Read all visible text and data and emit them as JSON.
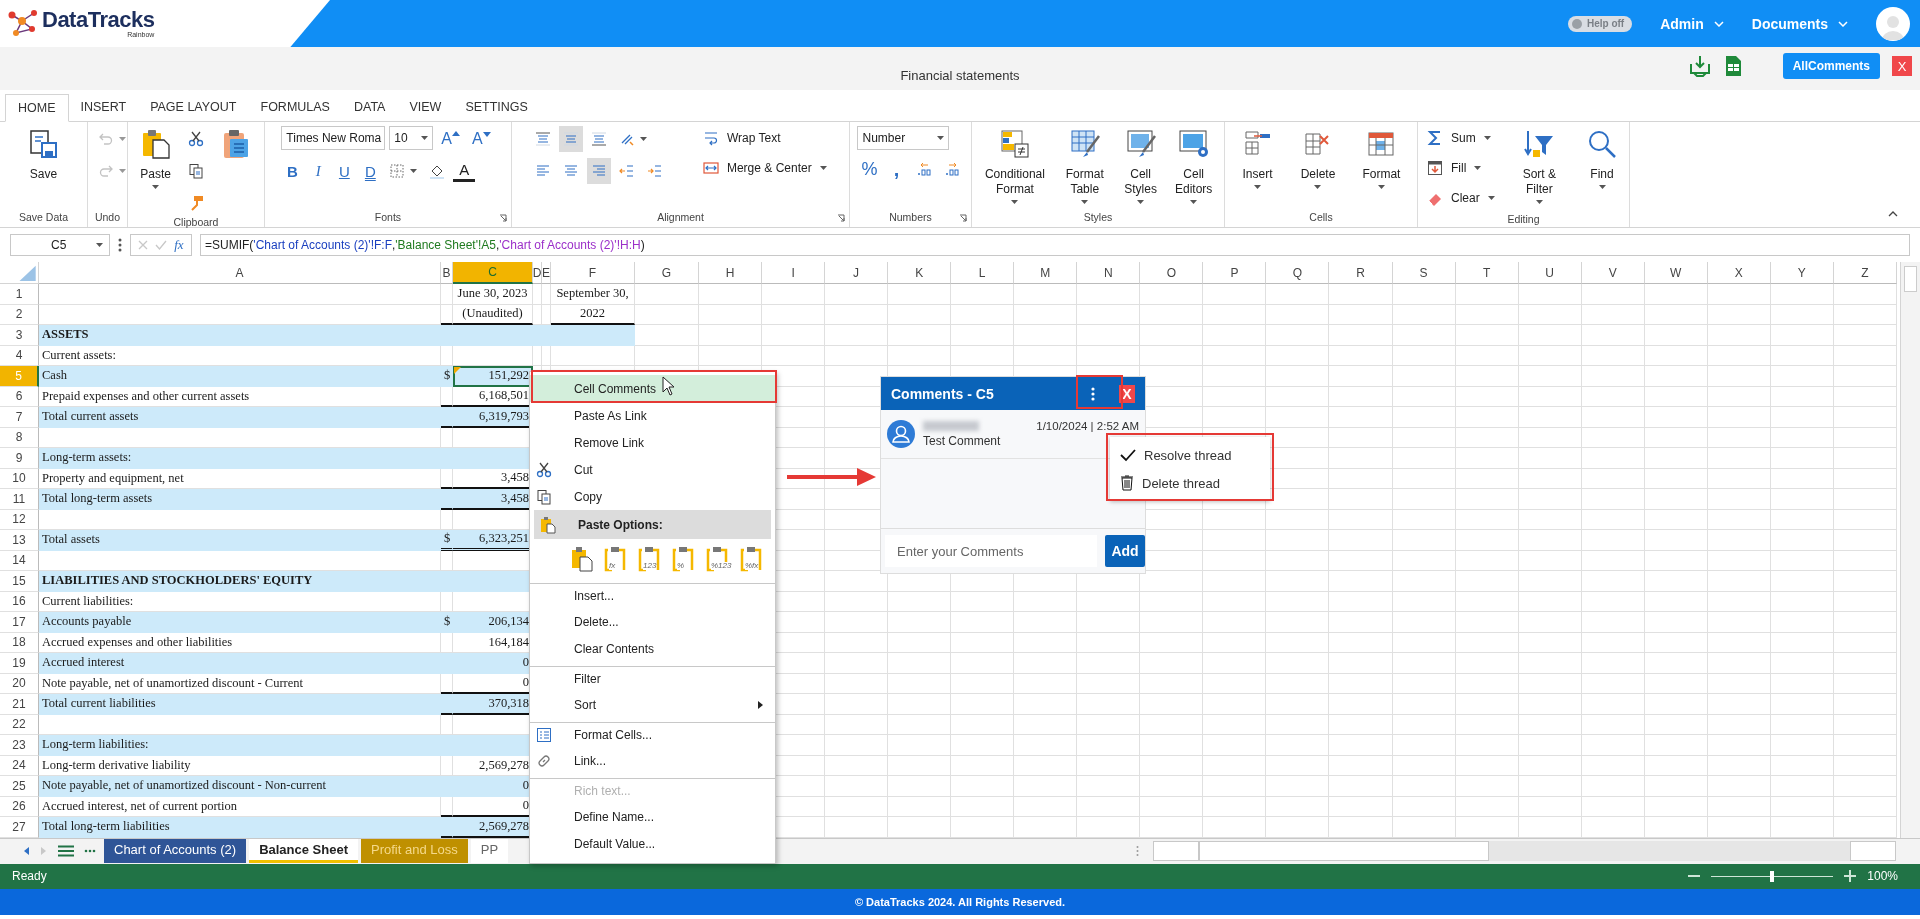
{
  "header": {
    "logo": "DataTracks",
    "logo_sub": "Rainbow",
    "help": {
      "label": "Help off",
      "on": false
    },
    "menus": [
      "Admin",
      "Documents"
    ]
  },
  "document": {
    "title": "Financial statements",
    "comments_button": "AllComments",
    "close_button": "X"
  },
  "ribbon_tabs": [
    {
      "label": "HOME",
      "selected": true
    },
    {
      "label": "INSERT",
      "selected": false
    },
    {
      "label": "PAGE LAYOUT",
      "selected": false
    },
    {
      "label": "FORMULAS",
      "selected": false
    },
    {
      "label": "DATA",
      "selected": false
    },
    {
      "label": "VIEW",
      "selected": false
    },
    {
      "label": "SETTINGS",
      "selected": false
    }
  ],
  "ribbon": {
    "groups": [
      {
        "title": "Save Data",
        "items": [
          {
            "kind": "large",
            "label": "Save"
          }
        ]
      },
      {
        "title": "Undo",
        "items": [
          {
            "kind": "column",
            "items": [
              {
                "kind": "icon",
                "caret": true,
                "disabled": true
              },
              {
                "kind": "icon",
                "caret": true,
                "disabled": true
              }
            ]
          }
        ]
      },
      {
        "title": "Clipboard",
        "items": [
          {
            "kind": "large",
            "label": "Paste",
            "caret": true
          },
          {
            "kind": "column",
            "items": [
              {
                "kind": "icon"
              },
              {
                "kind": "icon"
              },
              {
                "kind": "icon"
              }
            ]
          },
          {
            "kind": "large-icon"
          }
        ]
      },
      {
        "title": "Fonts",
        "launcher": true,
        "items": [
          {
            "kind": "column",
            "items": [
              {
                "kind": "row",
                "items": [
                  {
                    "kind": "font-select",
                    "value": "Times New Roma"
                  },
                  {
                    "kind": "size-select",
                    "value": "10"
                  },
                  {
                    "kind": "glyph-arrow",
                    "label": "A"
                  },
                  {
                    "kind": "glyph-arrow",
                    "label": "A"
                  }
                ]
              },
              {
                "kind": "row",
                "items": [
                  {
                    "kind": "bold",
                    "label": "B"
                  },
                  {
                    "kind": "italic",
                    "label": "I"
                  },
                  {
                    "kind": "underline",
                    "label": "U"
                  },
                  {
                    "kind": "double",
                    "label": "D"
                  },
                  {
                    "kind": "icon",
                    "caret": true
                  },
                  {
                    "kind": "icon"
                  },
                  {
                    "kind": "fontcolor",
                    "label": "A"
                  }
                ]
              }
            ]
          }
        ]
      },
      {
        "title": "Alignment",
        "launcher": true,
        "items": [
          {
            "kind": "column",
            "items": [
              {
                "kind": "row",
                "items": [
                  {
                    "kind": "icon",
                    "selected": false
                  },
                  {
                    "kind": "icon",
                    "selected": true
                  },
                  {
                    "kind": "icon",
                    "selected": false
                  },
                  {
                    "kind": "icon",
                    "caret": true
                  }
                ]
              },
              {
                "kind": "row",
                "items": [
                  {
                    "kind": "icon",
                    "selected": false
                  },
                  {
                    "kind": "icon",
                    "selected": false
                  },
                  {
                    "kind": "icon",
                    "selected": true
                  },
                  {
                    "kind": "icon"
                  },
                  {
                    "kind": "icon"
                  }
                ]
              }
            ]
          },
          {
            "kind": "column",
            "items": [
              {
                "kind": "small",
                "label": "Wrap Text"
              },
              {
                "kind": "small",
                "label": "Merge & Center",
                "caret": true
              }
            ]
          }
        ]
      },
      {
        "title": "Numbers",
        "launcher": true,
        "items": [
          {
            "kind": "column",
            "items": [
              {
                "kind": "format-select",
                "value": "Number"
              },
              {
                "kind": "row",
                "items": [
                  {
                    "kind": "percent",
                    "label": "%"
                  },
                  {
                    "kind": "comma",
                    "label": ","
                  },
                  {
                    "kind": "icon"
                  },
                  {
                    "kind": "icon"
                  }
                ]
              }
            ]
          }
        ]
      },
      {
        "title": "Styles",
        "items": [
          {
            "kind": "large",
            "label": "Conditional Format",
            "caret": true
          },
          {
            "kind": "large",
            "label": "Format Table",
            "caret": true
          },
          {
            "kind": "large",
            "label": "Cell Styles",
            "caret": true
          },
          {
            "kind": "large",
            "label": "Cell Editors",
            "caret": true
          }
        ]
      },
      {
        "title": "Cells",
        "items": [
          {
            "kind": "large",
            "label": "Insert",
            "caret": true
          },
          {
            "kind": "large",
            "label": "Delete",
            "caret": true
          },
          {
            "kind": "large",
            "label": "Format",
            "caret": true
          }
        ]
      },
      {
        "title": "Editing",
        "items": [
          {
            "kind": "column",
            "items": [
              {
                "kind": "small",
                "label": "Sum",
                "caret": true
              },
              {
                "kind": "small",
                "label": "Fill",
                "caret": true
              },
              {
                "kind": "small",
                "label": "Clear",
                "caret": true
              }
            ]
          },
          {
            "kind": "large",
            "label": "Sort & Filter",
            "caret": true
          },
          {
            "kind": "large",
            "label": "Find",
            "caret": true
          }
        ]
      }
    ]
  },
  "formula_bar": {
    "name_box": "C5",
    "fx": "fx",
    "segments": [
      {
        "text": "=SUMIF("
      },
      {
        "text": "'Chart of Accounts (2)'!F:F",
        "color": "#1a3fbf"
      },
      {
        "text": ","
      },
      {
        "text": "'Balance Sheet'!A5",
        "color": "#1f7a1f"
      },
      {
        "text": ","
      },
      {
        "text": "'Chart of Accounts (2)'!H:H",
        "color": "#9b2fc9"
      },
      {
        "text": ")"
      }
    ]
  },
  "sheet": {
    "columns": [
      {
        "label": "A",
        "selected": false
      },
      {
        "label": "B",
        "selected": false
      },
      {
        "label": "C",
        "selected": true
      },
      {
        "label": "D",
        "selected": false
      },
      {
        "label": "E",
        "selected": false
      },
      {
        "label": "F",
        "selected": false
      },
      {
        "label": "G",
        "selected": false
      },
      {
        "label": "H",
        "selected": false
      },
      {
        "label": "I",
        "selected": false
      },
      {
        "label": "J",
        "selected": false
      },
      {
        "label": "K",
        "selected": false
      },
      {
        "label": "L",
        "selected": false
      },
      {
        "label": "M",
        "selected": false
      },
      {
        "label": "N",
        "selected": false
      },
      {
        "label": "O",
        "selected": false
      },
      {
        "label": "P",
        "selected": false
      },
      {
        "label": "Q",
        "selected": false
      },
      {
        "label": "R",
        "selected": false
      },
      {
        "label": "S",
        "selected": false
      },
      {
        "label": "T",
        "selected": false
      },
      {
        "label": "U",
        "selected": false
      },
      {
        "label": "V",
        "selected": false
      },
      {
        "label": "W",
        "selected": false
      },
      {
        "label": "X",
        "selected": false
      },
      {
        "label": "Y",
        "selected": false
      },
      {
        "label": "Z",
        "selected": false
      }
    ],
    "rows": [
      {
        "number": "1",
        "kind": "normal",
        "band": false,
        "rule": false,
        "selected": false,
        "c": "June 30, 2023",
        "f": "September 30,"
      },
      {
        "number": "2",
        "kind": "normal",
        "band": false,
        "rule": true,
        "selected": false,
        "c": "(Unaudited)",
        "f": "2022"
      },
      {
        "number": "3",
        "kind": "heading",
        "band": true,
        "band_wide": true,
        "rule": false,
        "selected": false,
        "a": "ASSETS"
      },
      {
        "number": "4",
        "kind": "normal",
        "band": false,
        "rule": false,
        "selected": false,
        "a": "Current assets:"
      },
      {
        "number": "5",
        "kind": "normal",
        "band": true,
        "rule": false,
        "selected": true,
        "comment": true,
        "a": "Cash",
        "b": "$",
        "c": "151,292"
      },
      {
        "number": "6",
        "kind": "normal",
        "band": false,
        "rule": true,
        "selected": false,
        "a": "Prepaid expenses and other current assets",
        "c": "6,168,501"
      },
      {
        "number": "7",
        "kind": "normal",
        "band": true,
        "rule": true,
        "selected": false,
        "a": "Total current assets",
        "c": "6,319,793"
      },
      {
        "number": "8",
        "kind": "normal",
        "band": false,
        "rule": false,
        "selected": false
      },
      {
        "number": "9",
        "kind": "normal",
        "band": true,
        "rule": false,
        "selected": false,
        "a": "Long-term assets:"
      },
      {
        "number": "10",
        "kind": "normal",
        "band": false,
        "rule": true,
        "selected": false,
        "a": "Property and equipment, net",
        "c": "3,458"
      },
      {
        "number": "11",
        "kind": "normal",
        "band": true,
        "rule": true,
        "selected": false,
        "a": "Total long-term assets",
        "c": "3,458"
      },
      {
        "number": "12",
        "kind": "normal",
        "band": false,
        "rule": false,
        "selected": false
      },
      {
        "number": "13",
        "kind": "normal",
        "band": true,
        "rule": true,
        "double_rule": true,
        "selected": false,
        "a": "Total assets",
        "b": "$",
        "c": "6,323,251"
      },
      {
        "number": "14",
        "kind": "normal",
        "band": false,
        "rule": false,
        "selected": false
      },
      {
        "number": "15",
        "kind": "heading",
        "band": true,
        "rule": false,
        "selected": false,
        "a": "LIABILITIES AND STOCKHOLDERS' EQUITY"
      },
      {
        "number": "16",
        "kind": "normal",
        "band": false,
        "rule": false,
        "selected": false,
        "a": "Current liabilities:"
      },
      {
        "number": "17",
        "kind": "normal",
        "band": true,
        "rule": false,
        "selected": false,
        "a": "Accounts payable",
        "b": "$",
        "c": "206,134"
      },
      {
        "number": "18",
        "kind": "normal",
        "band": false,
        "rule": false,
        "selected": false,
        "a": "Accrued expenses and other liabilities",
        "c": "164,184"
      },
      {
        "number": "19",
        "kind": "normal",
        "band": true,
        "rule": false,
        "selected": false,
        "a": "Accrued interest",
        "c": "0"
      },
      {
        "number": "20",
        "kind": "normal",
        "band": false,
        "rule": true,
        "selected": false,
        "a": "Note payable, net of unamortized discount - Current",
        "c": "0"
      },
      {
        "number": "21",
        "kind": "normal",
        "band": true,
        "rule": true,
        "selected": false,
        "a": "Total current liabilities",
        "c": "370,318"
      },
      {
        "number": "22",
        "kind": "normal",
        "band": false,
        "rule": false,
        "selected": false
      },
      {
        "number": "23",
        "kind": "normal",
        "band": true,
        "rule": false,
        "selected": false,
        "a": "Long-term liabilities:"
      },
      {
        "number": "24",
        "kind": "normal",
        "band": false,
        "rule": false,
        "selected": false,
        "a": "Long-term derivative liability",
        "c": "2,569,278"
      },
      {
        "number": "25",
        "kind": "normal",
        "band": true,
        "rule": false,
        "selected": false,
        "a": "Note payable, net of unamortized discount - Non-current",
        "c": "0"
      },
      {
        "number": "26",
        "kind": "normal",
        "band": false,
        "rule": true,
        "selected": false,
        "a": "Accrued interest, net of current portion",
        "c": "0"
      },
      {
        "number": "27",
        "kind": "normal",
        "band": true,
        "rule": true,
        "selected": false,
        "a": "Total long-term liabilities",
        "c": "2,569,278"
      }
    ]
  },
  "sheet_tabs": [
    {
      "label": "Chart of Accounts (2)",
      "selected": false,
      "color": "#2f5597"
    },
    {
      "label": "Balance Sheet",
      "selected": true,
      "color": "#f0c000"
    },
    {
      "label": "Profit and Loss",
      "selected": false,
      "color": "#bf9000"
    },
    {
      "label": "PP",
      "selected": false,
      "color": "#ffffff"
    }
  ],
  "context_menu": {
    "items": [
      {
        "kind": "plain",
        "label": "Cell Comments",
        "selected": true,
        "divider": false,
        "disabled": false
      },
      {
        "kind": "plain",
        "label": "Paste As Link",
        "selected": false,
        "divider": false,
        "disabled": false
      },
      {
        "kind": "plain",
        "label": "Remove Link",
        "selected": false,
        "divider": false,
        "disabled": false
      },
      {
        "kind": "cut",
        "label": "Cut",
        "selected": false,
        "divider": false,
        "disabled": false
      },
      {
        "kind": "copy",
        "label": "Copy",
        "selected": false,
        "divider": false,
        "disabled": false
      },
      {
        "kind": "header",
        "label": "Paste Options:"
      },
      {
        "kind": "paste-row",
        "badges": [
          "fx",
          "123",
          "%",
          "%123",
          "%fx"
        ]
      },
      {
        "kind": "plain",
        "label": "Insert...",
        "selected": false,
        "divider": true,
        "disabled": false
      },
      {
        "kind": "plain",
        "label": "Delete...",
        "selected": false,
        "divider": false,
        "disabled": false
      },
      {
        "kind": "plain",
        "label": "Clear Contents",
        "selected": false,
        "divider": false,
        "disabled": false
      },
      {
        "kind": "plain",
        "label": "Filter",
        "selected": false,
        "divider": true,
        "disabled": false
      },
      {
        "kind": "submenu",
        "label": "Sort",
        "selected": false,
        "divider": false,
        "disabled": false
      },
      {
        "kind": "format",
        "label": "Format Cells...",
        "selected": false,
        "divider": true,
        "disabled": false
      },
      {
        "kind": "link",
        "label": "Link...",
        "selected": false,
        "divider": false,
        "disabled": false
      },
      {
        "kind": "plain",
        "label": "Rich text...",
        "selected": false,
        "divider": true,
        "disabled": true
      },
      {
        "kind": "plain",
        "label": "Define Name...",
        "selected": false,
        "divider": false,
        "disabled": false
      },
      {
        "kind": "plain",
        "label": "Default Value...",
        "selected": false,
        "divider": false,
        "disabled": false
      }
    ]
  },
  "comments": {
    "title": "Comments - C5",
    "close": "X",
    "entries": [
      {
        "date": "1/10/2024 | 2:52 AM",
        "text": "Test Comment"
      }
    ],
    "placeholder": "Enter your Comments",
    "add_button": "Add",
    "menu": [
      {
        "kind": "resolve",
        "label": "Resolve thread"
      },
      {
        "kind": "delete",
        "label": "Delete thread"
      }
    ]
  },
  "status_bar": {
    "status": "Ready",
    "zoom": {
      "level": 0.5,
      "reading": "100%"
    }
  },
  "footer": {
    "text": "© DataTracks 2024. All Rights Reserved."
  }
}
